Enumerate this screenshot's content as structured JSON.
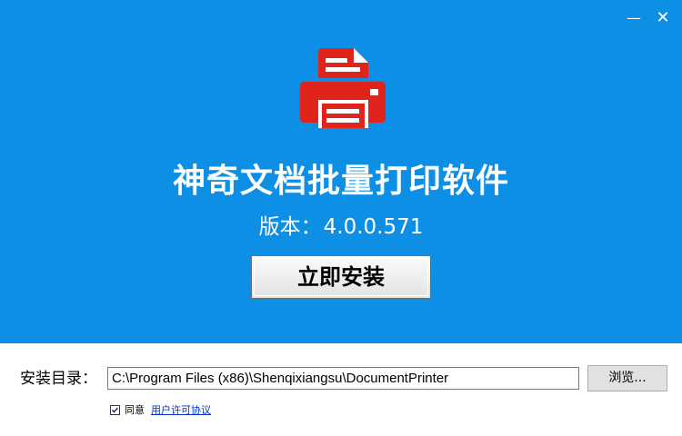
{
  "window": {
    "minimize_glyph": "—",
    "close_glyph": "✕"
  },
  "banner": {
    "background_color": "#0d8fe6",
    "logo_icon": "printer-icon",
    "logo_color": "#e0241b",
    "title": "神奇文档批量打印软件",
    "version_label": "版本：",
    "version_number": "4.0.0.571",
    "install_button_label": "立即安装"
  },
  "install_dir": {
    "label": "安装目录：",
    "path": "C:\\Program Files (x86)\\Shenqixiangsu\\DocumentPrinter",
    "browse_button_label": "浏览..."
  },
  "agreement": {
    "checked": true,
    "agree_label": "同意",
    "license_link_text": "用户许可协议"
  }
}
